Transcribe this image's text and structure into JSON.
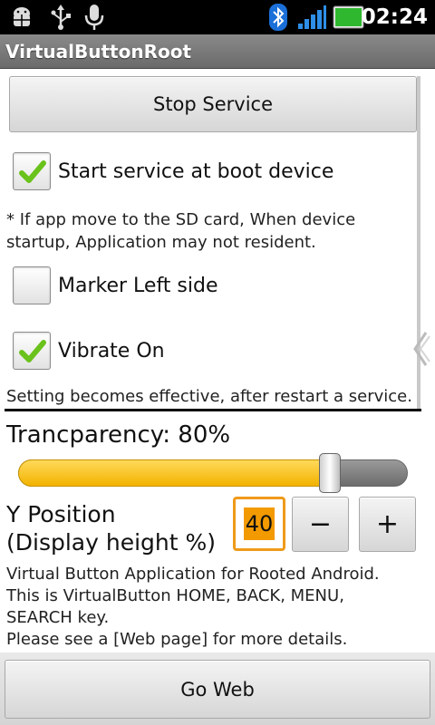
{
  "status_bar": {
    "time": "02:24",
    "icons": [
      "android-debug-icon",
      "usb-icon",
      "microphone-icon",
      "bluetooth-icon",
      "signal-icon",
      "battery-icon"
    ]
  },
  "app": {
    "title": "VirtualButtonRoot"
  },
  "buttons": {
    "stop_service": "Stop Service",
    "go_web": "Go Web",
    "minus": "−",
    "plus": "+"
  },
  "checkboxes": [
    {
      "label": "Start service at boot device",
      "checked": true
    },
    {
      "label": "Marker Left side",
      "checked": false
    },
    {
      "label": "Vibrate On",
      "checked": true
    }
  ],
  "sd_note_line1": "* If app move to the SD card, When device",
  "sd_note_line2": "startup, Application may not resident.",
  "setting_note": "Setting becomes effective, after restart a service.",
  "transparency": {
    "label": "Trancparency: 80%",
    "value_percent": 80
  },
  "y_position": {
    "label_line1": "Y Position",
    "label_line2": "(Display height %)",
    "value": "40"
  },
  "about": {
    "line1": "Virtual Button Application for Rooted Android.",
    "line2": "This is VirtualButton HOME, BACK, MENU,",
    "line3": "SEARCH key.",
    "line4": "Please see a [Web page] for more details."
  },
  "colors": {
    "slider_fill": "#f2b300",
    "check_green": "#6ac21c",
    "number_highlight": "#f29a00"
  }
}
